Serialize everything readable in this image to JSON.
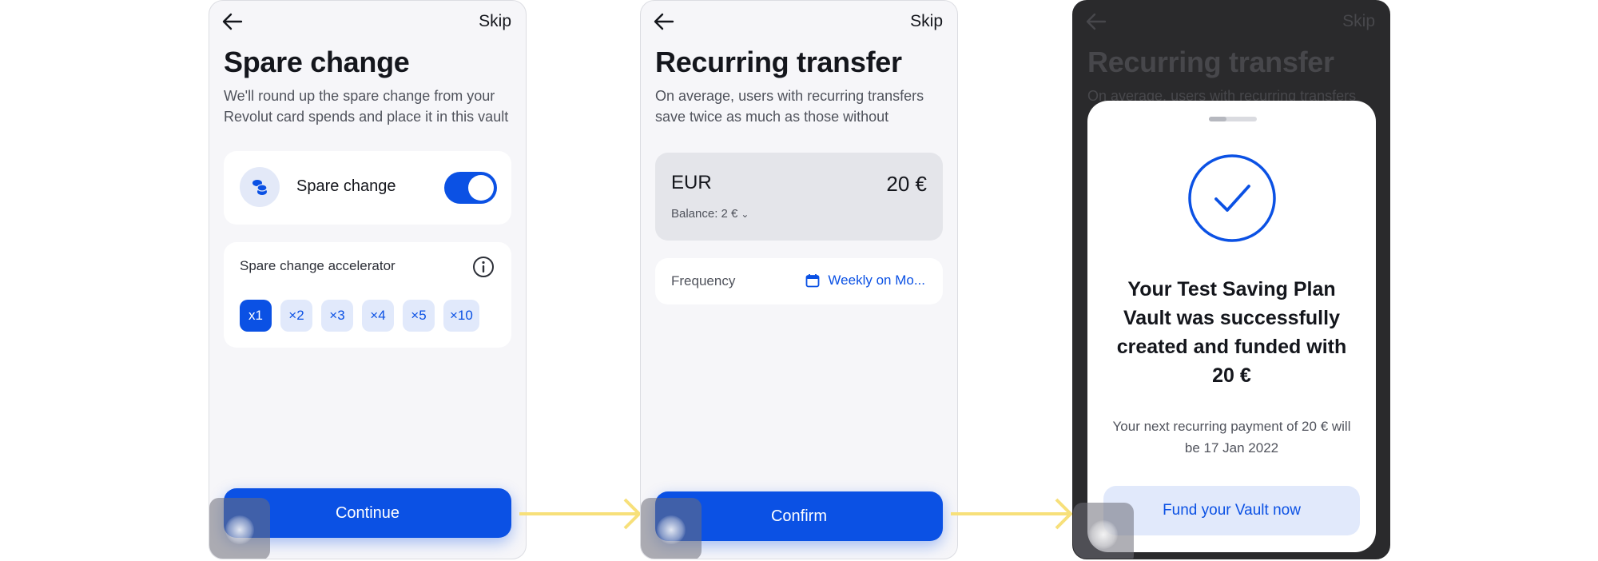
{
  "colors": {
    "accent": "#0b51e4",
    "accent_soft": "#e1e9fb",
    "connector": "#f7e07a"
  },
  "screen1": {
    "skip_label": "Skip",
    "title": "Spare change",
    "subtitle": "We'll round up the spare change from your Revolut card spends and place it in this vault",
    "toggle_label": "Spare change",
    "toggle_on": true,
    "accelerator_label": "Spare change accelerator",
    "multipliers": [
      "x1",
      "×2",
      "×3",
      "×4",
      "×5",
      "×10"
    ],
    "selected_multiplier": "x1",
    "continue_label": "Continue"
  },
  "screen2": {
    "skip_label": "Skip",
    "title": "Recurring transfer",
    "subtitle": "On average, users with recurring transfers save twice as much as those without",
    "currency": "EUR",
    "amount": "20 €",
    "balance": "Balance: 2 €",
    "frequency_label": "Frequency",
    "frequency_value": "Weekly on Mo...",
    "confirm_label": "Confirm"
  },
  "screen3": {
    "skip_label": "Skip",
    "title": "Recurring transfer",
    "subtitle": "On average, users with recurring transfers",
    "success_title": "Your Test Saving Plan Vault was successfully created and funded with 20 €",
    "success_sub": "Your next recurring payment of 20 € will be 17 Jan 2022",
    "fund_label": "Fund your Vault now"
  }
}
